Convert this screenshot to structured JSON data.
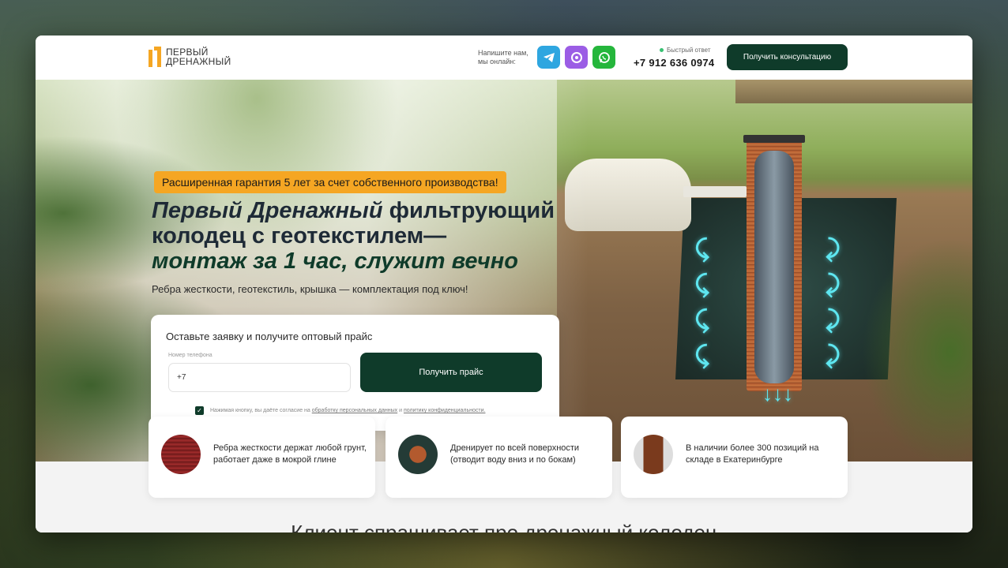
{
  "header": {
    "logo_line1": "ПЕРВЫЙ",
    "logo_line2": "ДРЕНАЖНЫЙ",
    "write_us": "Напишите нам, мы онлайн:",
    "messengers": [
      "telegram-icon",
      "max-messenger-icon",
      "whatsapp-icon"
    ],
    "fast_reply": "Быстрый ответ",
    "phone": "+7 912 636 0974",
    "consult_button": "Получить консультацию"
  },
  "hero": {
    "badge": "Расширенная гарантия 5 лет за счет собственного производства!",
    "title_italic": "Первый Дренажный",
    "title_rest": " фильтрующий колодец с геотекстилем—",
    "title_green": "монтаж за 1 час, служит вечно",
    "subtitle": "Ребра жесткости, геотекстиль, крышка — комплектация под ключ!"
  },
  "form": {
    "title": "Оставьте заявку и получите оптовый прайс",
    "phone_label": "Номер телефона",
    "phone_value": "+7",
    "submit": "Получить прайс",
    "agree_text": "Нажимая кнопку, вы даёте согласие на",
    "agree_link1": "обработку персональных данных",
    "agree_and": "и",
    "agree_link2": "политику конфиденциальности."
  },
  "features": [
    {
      "text": "Ребра жесткости держат любой грунт, работает даже в мокрой глине"
    },
    {
      "text": "Дренирует по всей поверхности (отводит воду вниз и по бокам)"
    },
    {
      "text": "В наличии более 300 позиций на складе в Екатеринбурге"
    }
  ],
  "next_section_heading": "Клиент спрашивает про дренажный колодец",
  "colors": {
    "accent_green": "#0f3b2a",
    "badge_orange": "#f5a623",
    "arrow_cyan": "#5ee6f0"
  }
}
